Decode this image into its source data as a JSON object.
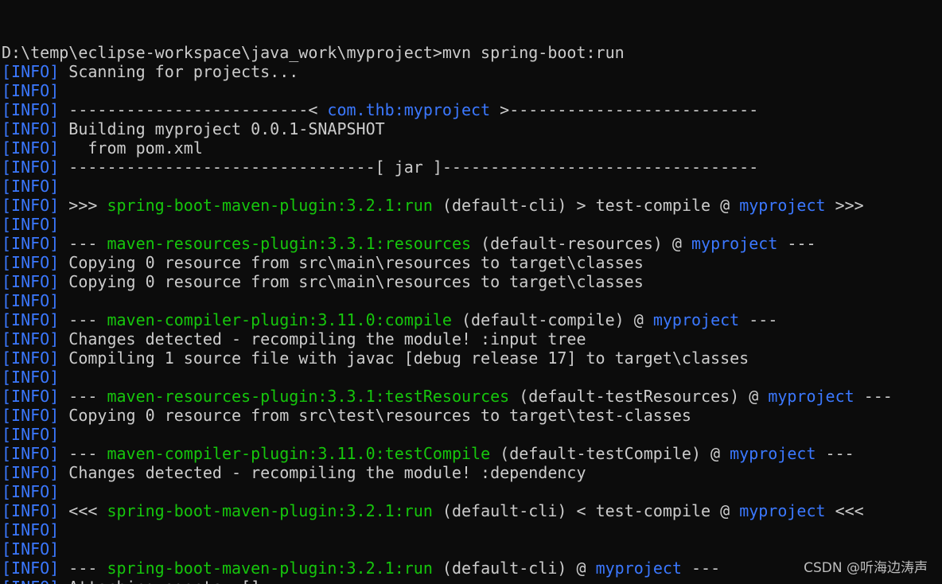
{
  "colors": {
    "background": "#0c0c0c",
    "default_text": "#cccccc",
    "info_tag": "#3b78ff",
    "highlight_blue": "#3b78ff",
    "highlight_green": "#16c60c"
  },
  "terminal": {
    "lines": [
      {
        "segs": [
          {
            "t": "D:\\temp\\eclipse-workspace\\java_work\\myproject>mvn spring-boot:run",
            "c": "default"
          }
        ]
      },
      {
        "segs": [
          {
            "t": "[INFO]",
            "c": "blue"
          },
          {
            "t": " Scanning for projects...",
            "c": "default"
          }
        ]
      },
      {
        "segs": [
          {
            "t": "[INFO]",
            "c": "blue"
          }
        ]
      },
      {
        "segs": [
          {
            "t": "[INFO]",
            "c": "blue"
          },
          {
            "t": " -------------------------< ",
            "c": "default"
          },
          {
            "t": "com.thb:myproject",
            "c": "blue"
          },
          {
            "t": " >--------------------------",
            "c": "default"
          }
        ]
      },
      {
        "segs": [
          {
            "t": "[INFO]",
            "c": "blue"
          },
          {
            "t": " Building myproject 0.0.1-SNAPSHOT",
            "c": "default"
          }
        ]
      },
      {
        "segs": [
          {
            "t": "[INFO]",
            "c": "blue"
          },
          {
            "t": "   from pom.xml",
            "c": "default"
          }
        ]
      },
      {
        "segs": [
          {
            "t": "[INFO]",
            "c": "blue"
          },
          {
            "t": " --------------------------------[ jar ]---------------------------------",
            "c": "default"
          }
        ]
      },
      {
        "segs": [
          {
            "t": "[INFO]",
            "c": "blue"
          }
        ]
      },
      {
        "segs": [
          {
            "t": "[INFO]",
            "c": "blue"
          },
          {
            "t": " >>> ",
            "c": "default"
          },
          {
            "t": "spring-boot-maven-plugin:3.2.1:run",
            "c": "green"
          },
          {
            "t": " (default-cli) > test-compile @ ",
            "c": "default"
          },
          {
            "t": "myproject",
            "c": "blue"
          },
          {
            "t": " >>>",
            "c": "default"
          }
        ]
      },
      {
        "segs": [
          {
            "t": "[INFO]",
            "c": "blue"
          }
        ]
      },
      {
        "segs": [
          {
            "t": "[INFO]",
            "c": "blue"
          },
          {
            "t": " --- ",
            "c": "default"
          },
          {
            "t": "maven-resources-plugin:3.3.1:resources",
            "c": "green"
          },
          {
            "t": " (default-resources) @ ",
            "c": "default"
          },
          {
            "t": "myproject",
            "c": "blue"
          },
          {
            "t": " ---",
            "c": "default"
          }
        ]
      },
      {
        "segs": [
          {
            "t": "[INFO]",
            "c": "blue"
          },
          {
            "t": " Copying 0 resource from src\\main\\resources to target\\classes",
            "c": "default"
          }
        ]
      },
      {
        "segs": [
          {
            "t": "[INFO]",
            "c": "blue"
          },
          {
            "t": " Copying 0 resource from src\\main\\resources to target\\classes",
            "c": "default"
          }
        ]
      },
      {
        "segs": [
          {
            "t": "[INFO]",
            "c": "blue"
          }
        ]
      },
      {
        "segs": [
          {
            "t": "[INFO]",
            "c": "blue"
          },
          {
            "t": " --- ",
            "c": "default"
          },
          {
            "t": "maven-compiler-plugin:3.11.0:compile",
            "c": "green"
          },
          {
            "t": " (default-compile) @ ",
            "c": "default"
          },
          {
            "t": "myproject",
            "c": "blue"
          },
          {
            "t": " ---",
            "c": "default"
          }
        ]
      },
      {
        "segs": [
          {
            "t": "[INFO]",
            "c": "blue"
          },
          {
            "t": " Changes detected - recompiling the module! :input tree",
            "c": "default"
          }
        ]
      },
      {
        "segs": [
          {
            "t": "[INFO]",
            "c": "blue"
          },
          {
            "t": " Compiling 1 source file with javac [debug release 17] to target\\classes",
            "c": "default"
          }
        ]
      },
      {
        "segs": [
          {
            "t": "[INFO]",
            "c": "blue"
          }
        ]
      },
      {
        "segs": [
          {
            "t": "[INFO]",
            "c": "blue"
          },
          {
            "t": " --- ",
            "c": "default"
          },
          {
            "t": "maven-resources-plugin:3.3.1:testResources",
            "c": "green"
          },
          {
            "t": " (default-testResources) @ ",
            "c": "default"
          },
          {
            "t": "myproject",
            "c": "blue"
          },
          {
            "t": " ---",
            "c": "default"
          }
        ]
      },
      {
        "segs": [
          {
            "t": "[INFO]",
            "c": "blue"
          },
          {
            "t": " Copying 0 resource from src\\test\\resources to target\\test-classes",
            "c": "default"
          }
        ]
      },
      {
        "segs": [
          {
            "t": "[INFO]",
            "c": "blue"
          }
        ]
      },
      {
        "segs": [
          {
            "t": "[INFO]",
            "c": "blue"
          },
          {
            "t": " --- ",
            "c": "default"
          },
          {
            "t": "maven-compiler-plugin:3.11.0:testCompile",
            "c": "green"
          },
          {
            "t": " (default-testCompile) @ ",
            "c": "default"
          },
          {
            "t": "myproject",
            "c": "blue"
          },
          {
            "t": " ---",
            "c": "default"
          }
        ]
      },
      {
        "segs": [
          {
            "t": "[INFO]",
            "c": "blue"
          },
          {
            "t": " Changes detected - recompiling the module! :dependency",
            "c": "default"
          }
        ]
      },
      {
        "segs": [
          {
            "t": "[INFO]",
            "c": "blue"
          }
        ]
      },
      {
        "segs": [
          {
            "t": "[INFO]",
            "c": "blue"
          },
          {
            "t": " <<< ",
            "c": "default"
          },
          {
            "t": "spring-boot-maven-plugin:3.2.1:run",
            "c": "green"
          },
          {
            "t": " (default-cli) < test-compile @ ",
            "c": "default"
          },
          {
            "t": "myproject",
            "c": "blue"
          },
          {
            "t": " <<<",
            "c": "default"
          }
        ]
      },
      {
        "segs": [
          {
            "t": "[INFO]",
            "c": "blue"
          }
        ]
      },
      {
        "segs": [
          {
            "t": "[INFO]",
            "c": "blue"
          }
        ]
      },
      {
        "segs": [
          {
            "t": "[INFO]",
            "c": "blue"
          },
          {
            "t": " --- ",
            "c": "default"
          },
          {
            "t": "spring-boot-maven-plugin:3.2.1:run",
            "c": "green"
          },
          {
            "t": " (default-cli) @ ",
            "c": "default"
          },
          {
            "t": "myproject",
            "c": "blue"
          },
          {
            "t": " ---",
            "c": "default"
          }
        ]
      },
      {
        "segs": [
          {
            "t": "[INFO]",
            "c": "blue"
          },
          {
            "t": " Attaching agents: []",
            "c": "default"
          }
        ]
      }
    ]
  },
  "watermark": "CSDN @听海边涛声"
}
